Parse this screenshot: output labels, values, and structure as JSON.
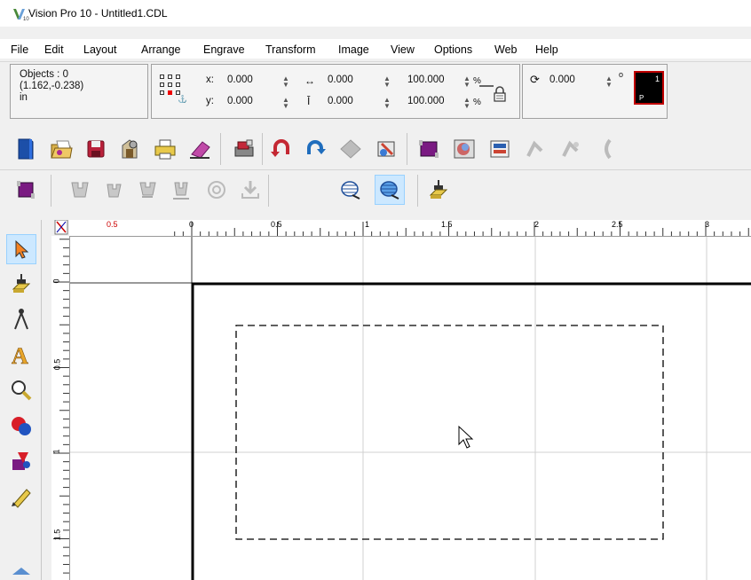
{
  "window": {
    "title": "Vision Pro 10 - Untitled1.CDL",
    "app_icon": "vision-pro-logo-icon"
  },
  "menu": [
    "File",
    "Edit",
    "Layout",
    "Arrange",
    "Engrave",
    "Transform",
    "Image",
    "View",
    "Options",
    "Web",
    "Help"
  ],
  "props": {
    "objects": "Objects : 0",
    "coords": "(1.162,-0.238)",
    "units": "in",
    "x_label": "x:",
    "x_value": "0.000",
    "y_label": "y:",
    "y_value": "0.000",
    "width_value": "0.000",
    "height_value": "0.000",
    "scale_x": "100.000",
    "scale_y": "100.000",
    "percent": "%",
    "rotation": "0.000",
    "degree": "o",
    "color_swatch_number": "1",
    "color_swatch_letter": "P",
    "colors": {
      "swatch_bg": "#000000",
      "swatch_border": "#c00000"
    }
  },
  "toolbar1": [
    "new-document-icon",
    "open-folder-icon",
    "save-icon",
    "import-icon",
    "print-icon",
    "eraser-icon",
    "engrave-machine-icon",
    "undo-icon",
    "redo-icon",
    "fill-icon",
    "edit-path-icon",
    "layer-icon",
    "image-edit-icon",
    "text-box-icon",
    "group-icon",
    "ungroup-icon",
    "more-icon"
  ],
  "toolbar2": [
    "layer-icon",
    "fixture-icon",
    "fixture-rotate-icon",
    "fixture-align-icon",
    "fixture-center-icon",
    "target-icon",
    "download-icon",
    "hatch-fill-icon",
    "hatch-fill-active-icon",
    "engrave-tool-icon"
  ],
  "toolbox": [
    "select-arrow-icon",
    "engrave-tool-icon",
    "compass-icon",
    "text-icon",
    "zoom-icon",
    "shapes-icon",
    "shape-edit-icon",
    "pen-icon",
    "more-tools-icon"
  ],
  "ruler": {
    "top": [
      "0.5",
      "0",
      "0.5",
      "1",
      "1.5",
      "2",
      "2.5",
      "3"
    ],
    "left": [
      "0",
      "0.5",
      "1",
      "1.5"
    ]
  }
}
